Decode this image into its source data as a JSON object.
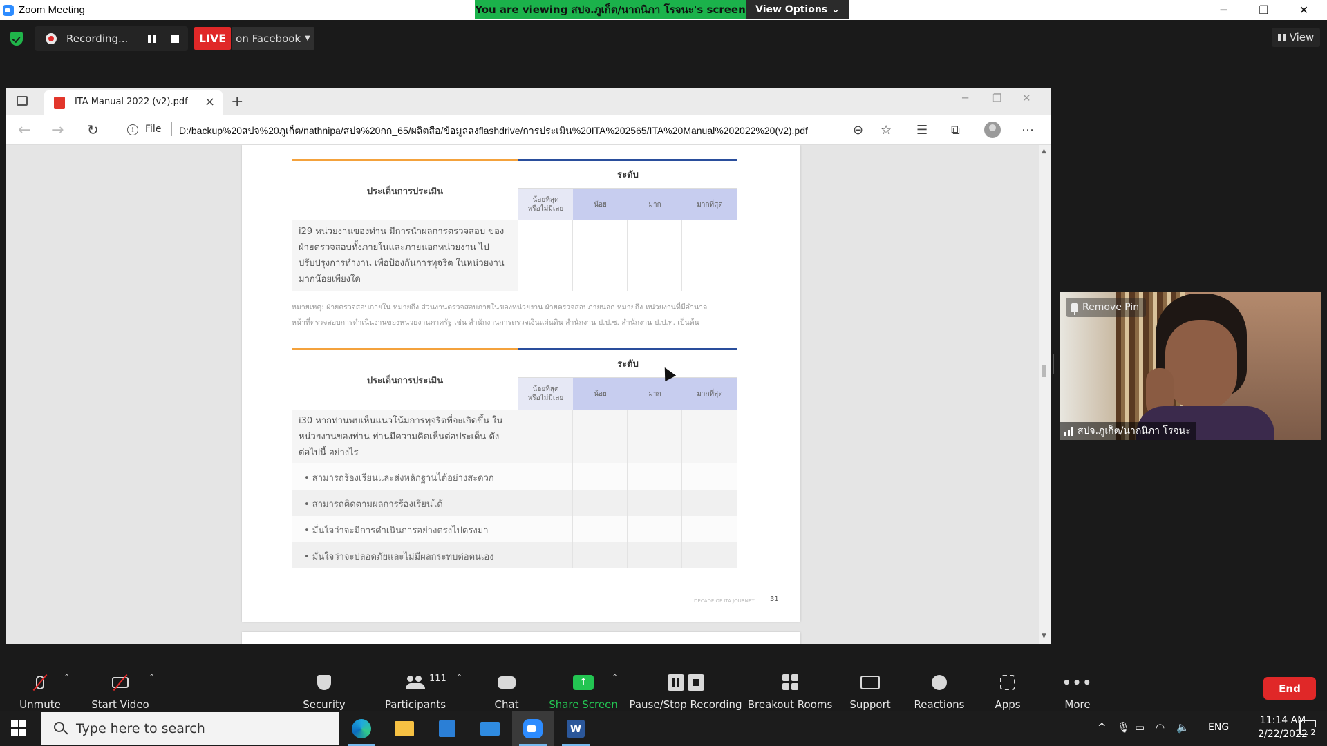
{
  "zoom": {
    "window_title": "Zoom Meeting",
    "share_banner": "You are viewing สปจ.ภูเก็ต/นาถนิภา โรจนะ's screen",
    "view_options": "View Options",
    "recording_label": "Recording...",
    "live_label": "LIVE",
    "live_destination": "on Facebook",
    "view_label": "View",
    "window_controls": [
      "─",
      "❐",
      "✕"
    ]
  },
  "browser": {
    "tab_title": "ITA Manual 2022 (v2).pdf",
    "url_scheme_label": "File",
    "url": "D:/backup%20สปจ%20ภูเก็ต/nathnipa/สปจ%20กก_65/ผลิตสื่อ/ข้อมูลลงflashdrive/การประเมิน%20ITA%202565/ITA%20Manual%202022%20(v2).pdf"
  },
  "document": {
    "table1": {
      "header_left": "ประเด็นการประเมิน",
      "header_level": "ระดับ",
      "level_cols": [
        "น้อยที่สุด\nหรือไม่มีเลย",
        "น้อย",
        "มาก",
        "มากที่สุด"
      ],
      "question": "i29 หน่วยงานของท่าน มีการนำผลการตรวจสอบ ของฝ่ายตรวจสอบทั้งภายในและภายนอกหน่วยงาน ไปปรับปรุงการทำงาน เพื่อป้องกันการทุจริต ในหน่วยงาน มากน้อยเพียงใด"
    },
    "note_line1": "หมายเหตุ: ฝ่ายตรวจสอบภายใน หมายถึง ส่วนงานตรวจสอบภายในของหน่วยงาน ฝ่ายตรวจสอบภายนอก หมายถึง หน่วยงานที่มีอำนาจ",
    "note_line2": "หน้าที่ตรวจสอบการดำเนินงานของหน่วยงานภาครัฐ เช่น สำนักงานการตรวจเงินแผ่นดิน สำนักงาน ป.ป.ช. สำนักงาน ป.ป.ท. เป็นต้น",
    "table2": {
      "header_left": "ประเด็นการประเมิน",
      "header_level": "ระดับ",
      "level_cols": [
        "น้อยที่สุด\nหรือไม่มีเลย",
        "น้อย",
        "มาก",
        "มากที่สุด"
      ],
      "question": "i30 หากท่านพบเห็นแนวโน้มการทุจริตที่จะเกิดขึ้น ในหน่วยงานของท่าน ท่านมีความคิดเห็นต่อประเด็น ดังต่อไปนี้ อย่างไร",
      "options": [
        "• สามารถร้องเรียนและส่งหลักฐานได้อย่างสะดวก",
        "• สามารถติดตามผลการร้องเรียนได้",
        "• มั่นใจว่าจะมีการดำเนินการอย่างตรงไปตรงมา",
        "• มั่นใจว่าจะปลอดภัยและไม่มีผลกระทบต่อตนเอง"
      ]
    },
    "footer_brand": "DECADE OF ITA JOURNEY",
    "page_number": "31"
  },
  "video": {
    "pin_label": "Remove Pin",
    "participant_name": "สปจ.ภูเก็ต/นาถนิภา โรจนะ"
  },
  "toolbar": {
    "unmute": "Unmute",
    "start_video": "Start Video",
    "security": "Security",
    "participants": "Participants",
    "participant_count": "111",
    "chat": "Chat",
    "share_screen": "Share Screen",
    "pause_stop_recording": "Pause/Stop Recording",
    "breakout_rooms": "Breakout Rooms",
    "support": "Support",
    "reactions": "Reactions",
    "apps": "Apps",
    "more": "More",
    "end": "End"
  },
  "taskbar": {
    "search_placeholder": "Type here to search",
    "language": "ENG",
    "time": "11:14 AM",
    "date": "2/22/2022",
    "notification_count": "2"
  },
  "colors": {
    "share_green": "#1bb24b",
    "live_red": "#e02828",
    "zoom_blue": "#2d8cff",
    "level_header_fill": "#c7cdef"
  }
}
